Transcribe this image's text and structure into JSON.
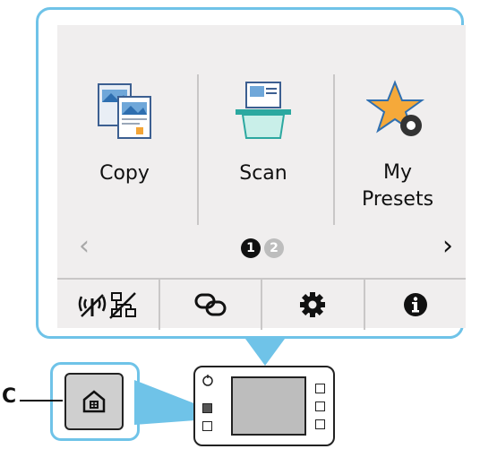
{
  "apps": [
    {
      "label": "Copy",
      "icon": "copy-icon"
    },
    {
      "label": "Scan",
      "icon": "scan-icon"
    },
    {
      "label": "My\nPresets",
      "icon": "my-presets-icon"
    }
  ],
  "pagination": {
    "pages": [
      "1",
      "2"
    ],
    "current": "1"
  },
  "bottom_bar": {
    "items": [
      "wireless-status-icon",
      "connect-icon",
      "settings-icon",
      "info-icon"
    ]
  },
  "callout": {
    "label": "C"
  },
  "colors": {
    "accent": "#6fc3e8",
    "screen_bg": "#f0eeee"
  }
}
